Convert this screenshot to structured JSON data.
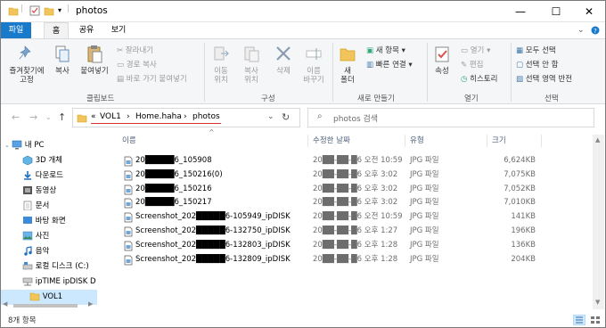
{
  "window": {
    "title": "photos",
    "minimize": "—",
    "maximize": "☐",
    "close": "✕"
  },
  "ribbon_tabs": {
    "file": "파일",
    "home": "홈",
    "share": "공유",
    "view": "보기"
  },
  "ribbon": {
    "clipboard": {
      "pin": "즐겨찾기에\n고정",
      "copy": "복사",
      "paste": "붙여넣기",
      "cut": "잘라내기",
      "copy_path": "경로 복사",
      "paste_shortcut": "바로 가기 붙여넣기",
      "group": "클립보드"
    },
    "organize": {
      "move_to": "이동\n위치",
      "copy_to": "복사\n위치",
      "delete": "삭제",
      "rename": "이름\n바꾸기",
      "group": "구성"
    },
    "new": {
      "new_folder": "새\n폴더",
      "new_item": "새 항목",
      "easy_access": "빠른 연결",
      "group": "새로 만들기"
    },
    "open": {
      "properties": "속성",
      "open": "열기",
      "edit": "편집",
      "history": "히스토리",
      "group": "열기"
    },
    "select": {
      "select_all": "모두 선택",
      "select_none": "선택 안 함",
      "invert": "선택 영역 반전",
      "group": "선택"
    }
  },
  "address": {
    "overflow": "«",
    "crumbs": [
      "VOL1",
      "Home.haha",
      "photos"
    ],
    "separator": "›"
  },
  "search": {
    "placeholder": "photos 검색"
  },
  "nav": {
    "items": [
      {
        "label": "내 PC",
        "icon": "pc-icon"
      },
      {
        "label": "3D 개체",
        "icon": "cube-icon"
      },
      {
        "label": "다운로드",
        "icon": "download-icon"
      },
      {
        "label": "동영상",
        "icon": "video-icon"
      },
      {
        "label": "문서",
        "icon": "document-icon"
      },
      {
        "label": "바탕 화면",
        "icon": "desktop-icon"
      },
      {
        "label": "사진",
        "icon": "pictures-icon"
      },
      {
        "label": "음악",
        "icon": "music-icon"
      },
      {
        "label": "로컬 디스크 (C:)",
        "icon": "drive-icon"
      },
      {
        "label": "ipTIME ipDISK D",
        "icon": "network-drive-icon"
      },
      {
        "label": "VOL1",
        "icon": "folder-icon"
      }
    ]
  },
  "columns": {
    "name": "이름",
    "date": "수정한 날짜",
    "type": "유형",
    "size": "크기"
  },
  "files": [
    {
      "name": "20█████6_105908",
      "date": "20██-██-█6 오전 10:59",
      "type": "JPG 파일",
      "size": "6,624KB"
    },
    {
      "name": "20█████6_150216(0)",
      "date": "20██-██-█6 오후 3:02",
      "type": "JPG 파일",
      "size": "7,075KB"
    },
    {
      "name": "20█████6_150216",
      "date": "20██-██-█6 오후 3:02",
      "type": "JPG 파일",
      "size": "7,052KB"
    },
    {
      "name": "20█████6_150217",
      "date": "20██-██-█6 오후 3:02",
      "type": "JPG 파일",
      "size": "7,010KB"
    },
    {
      "name": "Screenshot_202█████6-105949_ipDISK",
      "date": "20██-██-█6 오전 10:59",
      "type": "JPG 파일",
      "size": "141KB"
    },
    {
      "name": "Screenshot_202█████6-132750_ipDISK",
      "date": "20██-██-█6 오후 1:27",
      "type": "JPG 파일",
      "size": "196KB"
    },
    {
      "name": "Screenshot_202█████6-132803_ipDISK",
      "date": "20██-██-█6 오후 1:28",
      "type": "JPG 파일",
      "size": "136KB"
    },
    {
      "name": "Screenshot_202█████6-132809_ipDISK",
      "date": "20██-██-█6 오후 1:28",
      "type": "JPG 파일",
      "size": "204KB"
    }
  ],
  "status": {
    "count": "8개 항목"
  }
}
